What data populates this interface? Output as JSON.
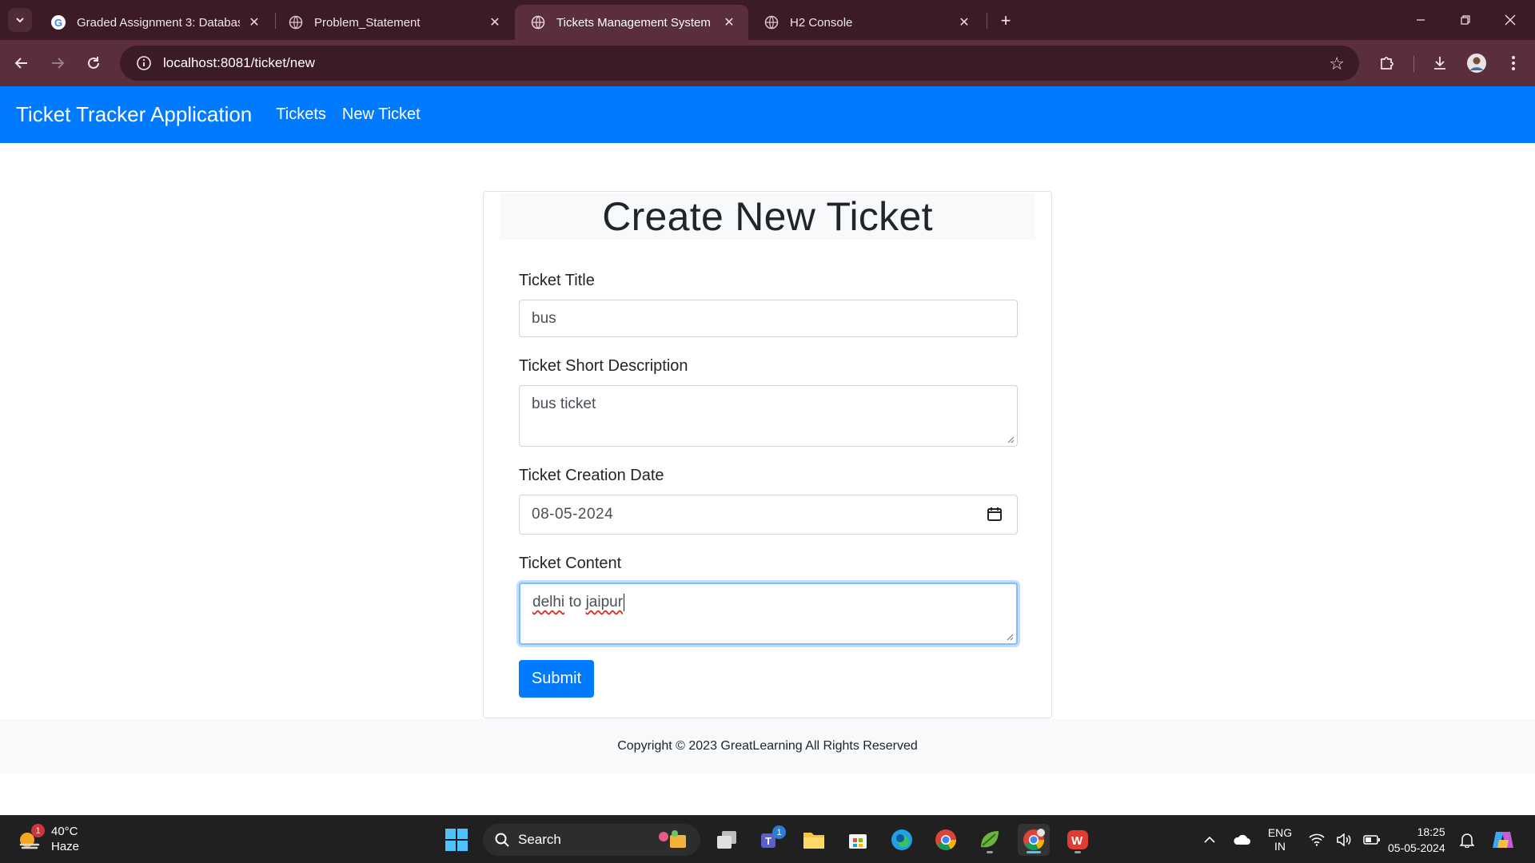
{
  "browser": {
    "tabs": [
      {
        "label": "Graded Assignment 3: Databas",
        "favicon": "google-icon"
      },
      {
        "label": "Problem_Statement",
        "favicon": "globe-icon"
      },
      {
        "label": "Tickets Management System",
        "favicon": "globe-icon",
        "active": true
      },
      {
        "label": "H2 Console",
        "favicon": "globe-icon"
      }
    ],
    "url": "localhost:8081/ticket/new"
  },
  "app": {
    "brand": "Ticket Tracker Application",
    "nav": [
      "Tickets",
      "New Ticket"
    ],
    "nav_color": "#007bff"
  },
  "form": {
    "heading": "Create New Ticket",
    "title_label": "Ticket Title",
    "title_value": "bus",
    "desc_label": "Ticket Short Description",
    "desc_value": "bus ticket",
    "date_label": "Ticket Creation Date",
    "date_value": "08-05-2024",
    "content_label": "Ticket Content",
    "content_word1": "delhi",
    "content_word2": "to",
    "content_word3": "jaipur",
    "submit_label": "Submit"
  },
  "footer": {
    "text": "Copyright © 2023 GreatLearning All Rights Reserved"
  },
  "taskbar": {
    "weather_temp": "40°C",
    "weather_cond": "Haze",
    "weather_badge": "1",
    "search_label": "Search",
    "teams_badge": "1",
    "lang_1": "ENG",
    "lang_2": "IN",
    "time": "18:25",
    "date": "05-05-2024"
  }
}
